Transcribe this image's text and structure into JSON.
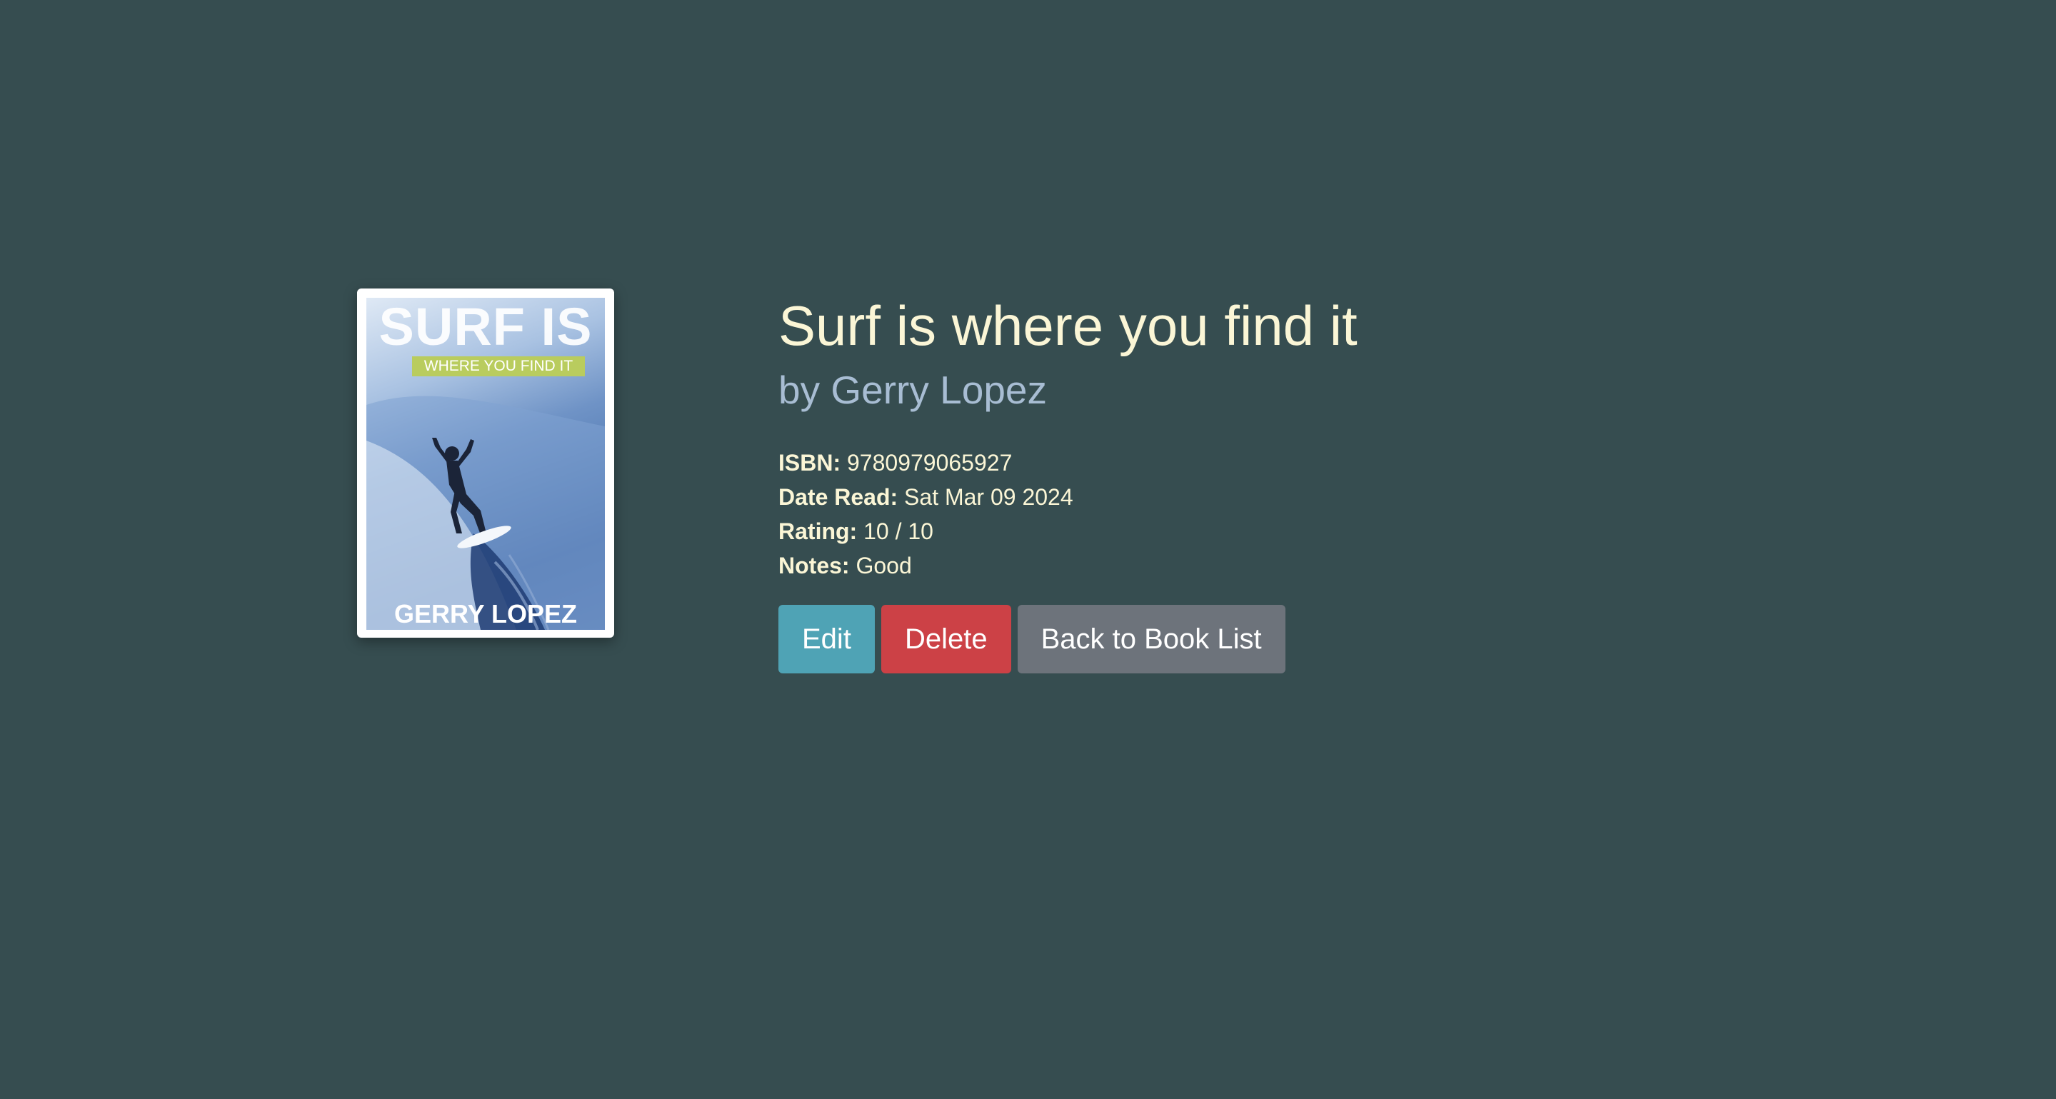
{
  "cover": {
    "title": "SURF IS",
    "subtitle": "WHERE YOU FIND IT",
    "author": "GERRY LOPEZ"
  },
  "book": {
    "title": "Surf is where you find it",
    "author_line": "by Gerry Lopez",
    "isbn_label": "ISBN:",
    "isbn": "9780979065927",
    "date_read_label": "Date Read:",
    "date_read": "Sat Mar 09 2024",
    "rating_label": "Rating:",
    "rating": "10 / 10",
    "notes_label": "Notes:",
    "notes": "Good"
  },
  "actions": {
    "edit_label": "Edit",
    "delete_label": "Delete",
    "back_label": "Back to Book List"
  },
  "colors": {
    "background": "#364d50",
    "title": "#fbf6d6",
    "author": "#a8bdd3",
    "edit_button": "#4fa3b5",
    "delete_button": "#cc4146",
    "back_button": "#6d737b"
  }
}
